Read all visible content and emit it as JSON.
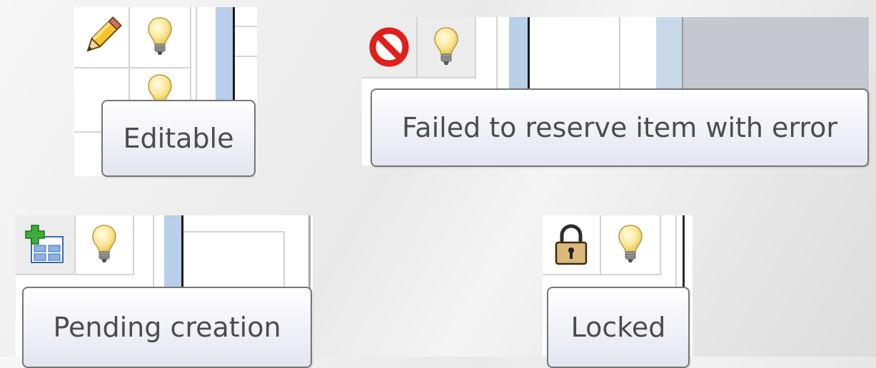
{
  "tooltips": {
    "editable": "Editable",
    "failed": "Failed to reserve item with error",
    "pending": "Pending creation",
    "locked": "Locked"
  },
  "icons": {
    "editable": "pencil-icon",
    "failed": "no-entry-icon",
    "pending": "add-item-icon",
    "locked": "padlock-icon",
    "hint": "lightbulb-icon"
  },
  "colors": {
    "tooltip_border": "#767676",
    "tooltip_text": "#4c4c4c",
    "selection_blue": "#b7cfe8",
    "error_red": "#e0201c"
  }
}
